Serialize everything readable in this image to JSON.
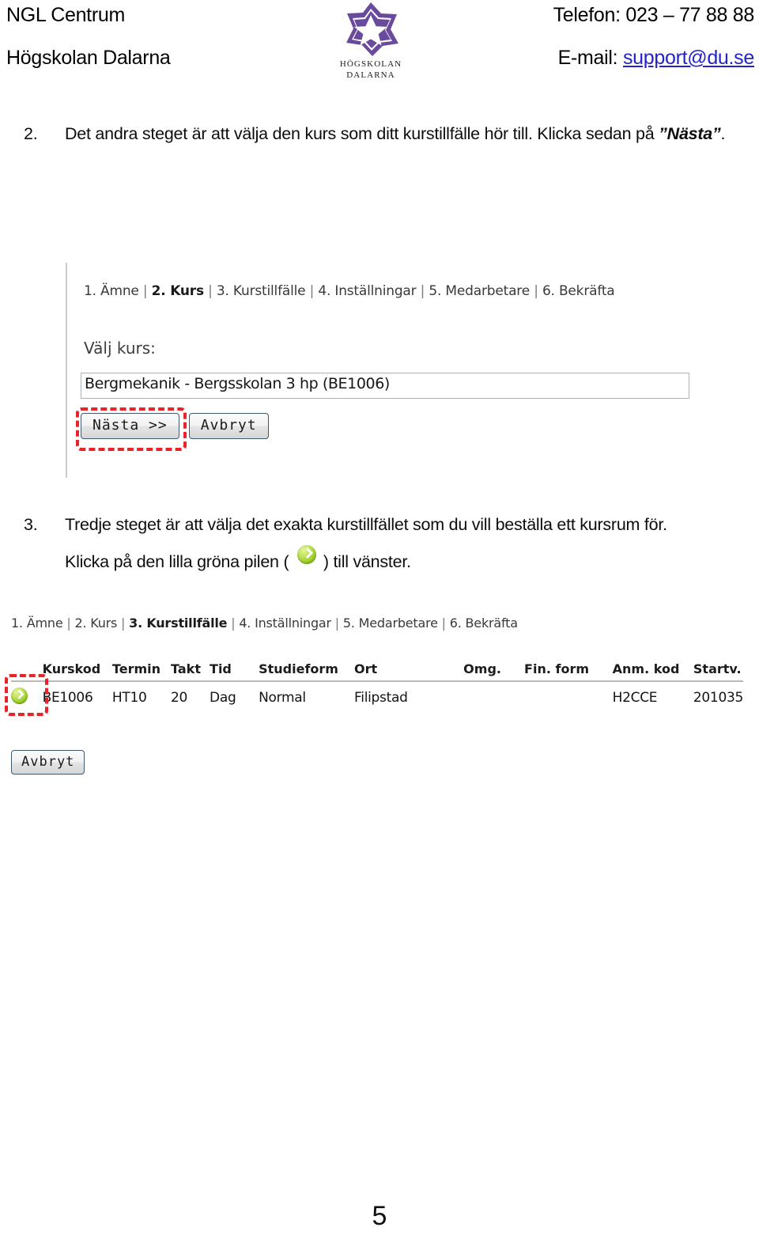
{
  "header": {
    "org_line1": "NGL Centrum",
    "org_line2": "Högskolan Dalarna",
    "phone": "Telefon: 023 – 77 88 88",
    "email_label": "E-mail:",
    "email_link": "support@du.se",
    "logo_line1": "HÖGSKOLAN",
    "logo_line2": "DALARNA",
    "logo_color": "#6a4a9c",
    "link_color": "#2323c8"
  },
  "steps": [
    {
      "number": "2.",
      "text_before": "Det andra steget är att välja den kurs som ditt kurstillfälle hör till. Klicka sedan på ",
      "emphasis": "”Nästa”",
      "text_after": "."
    },
    {
      "number": "3.",
      "line1": "Tredje steget är att välja det exakta kurstillfället som du vill beställa ett kursrum för.",
      "line2_before": "Klicka på den lilla gröna pilen ( ",
      "line2_after": " ) till vänster."
    }
  ],
  "screenshot1": {
    "breadcrumb": [
      {
        "label": "1. Ämne",
        "active": false
      },
      {
        "label": "2. Kurs",
        "active": true
      },
      {
        "label": "3. Kurstillfälle",
        "active": false
      },
      {
        "label": "4. Inställningar",
        "active": false
      },
      {
        "label": "5. Medarbetare",
        "active": false
      },
      {
        "label": "6. Bekräfta",
        "active": false
      }
    ],
    "separator": "|",
    "field_label": "Välj kurs:",
    "select_value": "Bergmekanik - Bergsskolan 3 hp (BE1006)",
    "next_button": "Nästa >>",
    "cancel_button": "Avbryt",
    "highlight_color": "#e8232a"
  },
  "screenshot2": {
    "breadcrumb": [
      {
        "label": "1. Ämne",
        "active": false
      },
      {
        "label": "2. Kurs",
        "active": false
      },
      {
        "label": "3. Kurstillfälle",
        "active": true
      },
      {
        "label": "4. Inställningar",
        "active": false
      },
      {
        "label": "5. Medarbetare",
        "active": false
      },
      {
        "label": "6. Bekräfta",
        "active": false
      }
    ],
    "separator": "|",
    "table": {
      "columns": [
        "",
        "Kurskod",
        "Termin",
        "Takt",
        "Tid",
        "Studieform",
        "Ort",
        "Omg.",
        "Fin. form",
        "Anm. kod",
        "Startv."
      ],
      "rows": [
        {
          "action_icon": "green-arrow-icon",
          "kurskod": "BE1006",
          "termin": "HT10",
          "takt": "20",
          "tid": "Dag",
          "studieform": "Normal",
          "ort": "Filipstad",
          "omg": "",
          "finform": "",
          "anmkod": "H2CCE",
          "startv": "201035"
        }
      ]
    },
    "cancel_button": "Avbryt"
  },
  "footer": {
    "page_number": "5"
  }
}
